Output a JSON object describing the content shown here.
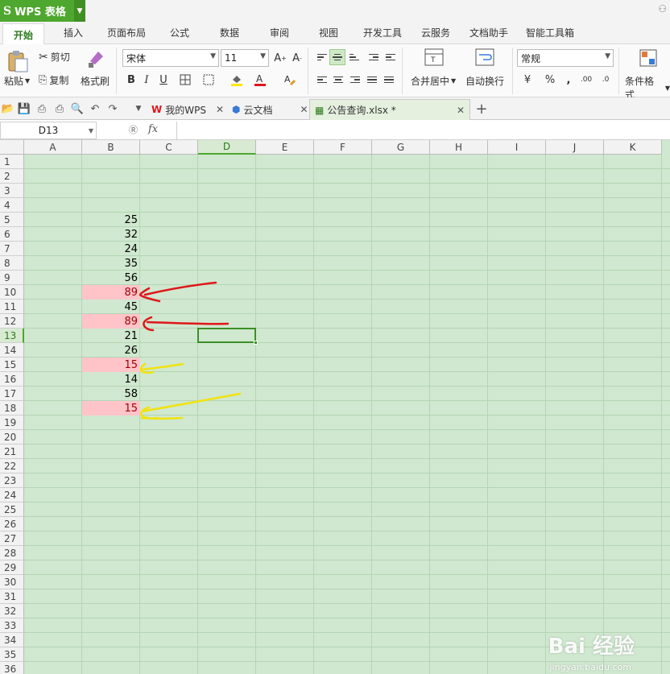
{
  "app": {
    "name": "WPS 表格",
    "logo": "S"
  },
  "ribbon_tabs": [
    "开始",
    "插入",
    "页面布局",
    "公式",
    "数据",
    "审阅",
    "视图",
    "开发工具",
    "云服务",
    "文档助手",
    "智能工具箱"
  ],
  "ribbon": {
    "paste": "粘贴",
    "cut": "剪切",
    "copy": "复制",
    "format_painter": "格式刷",
    "font_name": "宋体",
    "font_size": "11",
    "merge_center": "合并居中",
    "wrap_text": "自动换行",
    "number_format": "常规",
    "conditional_format": "条件格式",
    "percent": "%",
    "comma": ",",
    "dec_inc": ".00",
    "dec_dec": ".0"
  },
  "doc_tabs": [
    {
      "label": "我的WPS",
      "icon": "wps-icon"
    },
    {
      "label": "云文档",
      "icon": "cloud-doc-icon"
    },
    {
      "label": "公告查询.xlsx *",
      "icon": "sheet-icon",
      "active": true
    }
  ],
  "formula_bar": {
    "name_box": "D13",
    "fx": "fx",
    "value": ""
  },
  "columns": [
    "A",
    "B",
    "C",
    "D",
    "E",
    "F",
    "G",
    "H",
    "I",
    "J",
    "K"
  ],
  "active_column": "D",
  "active_row": 13,
  "rows": [
    "1",
    "2",
    "3",
    "4",
    "5",
    "6",
    "7",
    "8",
    "9",
    "10",
    "11",
    "12",
    "13",
    "14",
    "15",
    "16",
    "17",
    "18",
    "19",
    "20",
    "21",
    "22",
    "23",
    "24",
    "25",
    "26",
    "27",
    "28",
    "29",
    "30",
    "31",
    "32",
    "33",
    "34",
    "35",
    "36"
  ],
  "column_b_values": [
    {
      "row": 5,
      "value": "25",
      "highlight": false
    },
    {
      "row": 6,
      "value": "32",
      "highlight": false
    },
    {
      "row": 7,
      "value": "24",
      "highlight": false
    },
    {
      "row": 8,
      "value": "35",
      "highlight": false
    },
    {
      "row": 9,
      "value": "56",
      "highlight": false
    },
    {
      "row": 10,
      "value": "89",
      "highlight": true
    },
    {
      "row": 11,
      "value": "45",
      "highlight": false
    },
    {
      "row": 12,
      "value": "89",
      "highlight": true
    },
    {
      "row": 13,
      "value": "21",
      "highlight": false
    },
    {
      "row": 14,
      "value": "26",
      "highlight": false
    },
    {
      "row": 15,
      "value": "15",
      "highlight": true
    },
    {
      "row": 16,
      "value": "14",
      "highlight": false
    },
    {
      "row": 17,
      "value": "58",
      "highlight": false
    },
    {
      "row": 18,
      "value": "15",
      "highlight": true
    }
  ],
  "colors": {
    "brand": "#4ea72e",
    "grid_bg": "#cfe8cf",
    "highlight_fill": "#ffc4c8",
    "highlight_text": "#9c0006",
    "arrow_red": "#e0161b",
    "arrow_yellow": "#f2e20f"
  },
  "watermark": {
    "main": "Bai 经验",
    "sub": "jingyan.baidu.com"
  }
}
